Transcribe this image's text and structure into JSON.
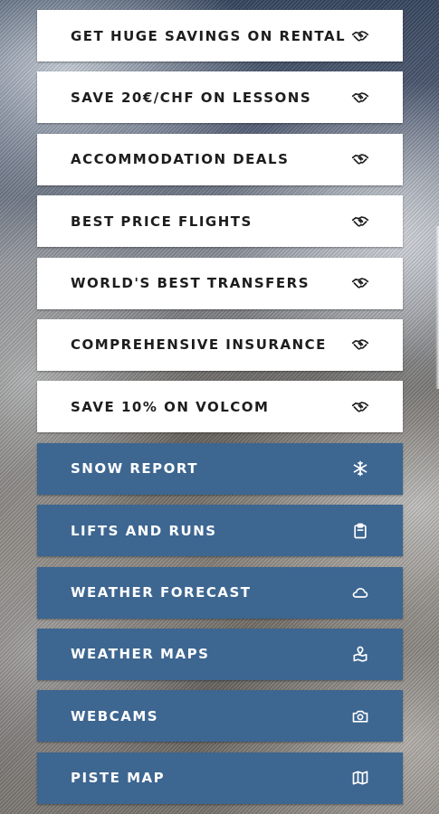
{
  "deals": [
    {
      "label": "GET HUGE SAVINGS ON RENTAL",
      "icon": "handshake-icon"
    },
    {
      "label": "SAVE 20€/CHF ON LESSONS",
      "icon": "handshake-icon"
    },
    {
      "label": "ACCOMMODATION DEALS",
      "icon": "handshake-icon"
    },
    {
      "label": "BEST PRICE FLIGHTS",
      "icon": "handshake-icon"
    },
    {
      "label": "WORLD'S BEST TRANSFERS",
      "icon": "handshake-icon"
    },
    {
      "label": "COMPREHENSIVE INSURANCE",
      "icon": "handshake-icon"
    },
    {
      "label": "SAVE 10% ON VOLCOM",
      "icon": "handshake-icon"
    }
  ],
  "info": [
    {
      "label": "SNOW REPORT",
      "icon": "snowflake-icon"
    },
    {
      "label": "LIFTS AND RUNS",
      "icon": "clipboard-icon"
    },
    {
      "label": "WEATHER FORECAST",
      "icon": "cloud-icon"
    },
    {
      "label": "WEATHER MAPS",
      "icon": "map-pin-icon"
    },
    {
      "label": "WEBCAMS",
      "icon": "camera-icon"
    },
    {
      "label": "PISTE MAP",
      "icon": "folded-map-icon"
    }
  ],
  "colors": {
    "deal_background": "#ffffff",
    "deal_text": "#1d1d1d",
    "info_background": "#3d6691",
    "info_text": "#ffffff"
  }
}
